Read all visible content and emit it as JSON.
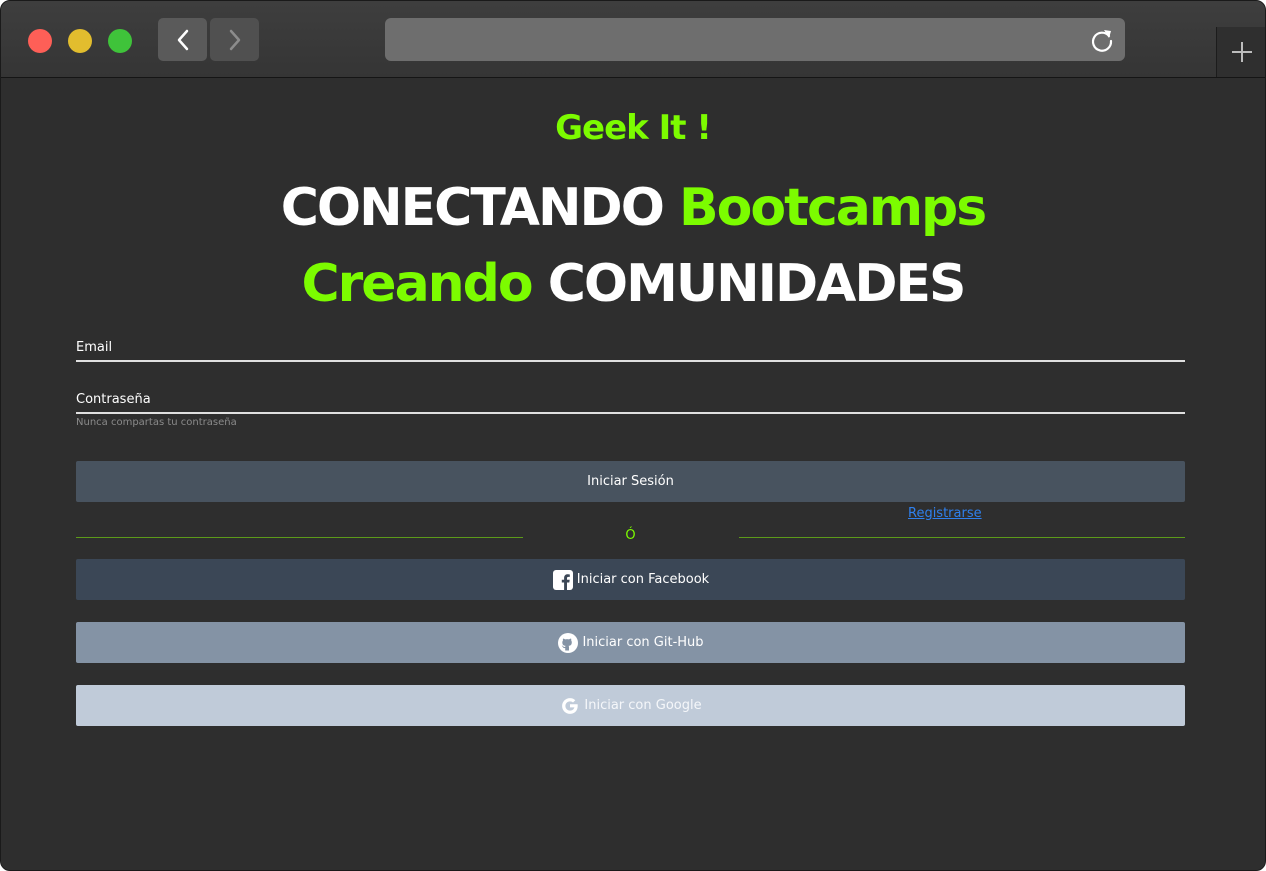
{
  "browser": {
    "back_icon": "chevron-left-icon",
    "forward_icon": "chevron-right-icon",
    "reload_icon": "reload-icon",
    "new_tab_icon": "plus-icon",
    "url": ""
  },
  "hero": {
    "brand": "Geek It !",
    "line1_a": "CONECTANDO",
    "line1_b": "Bootcamps",
    "line2_a": "Creando",
    "line2_b": "COMUNIDADES"
  },
  "form": {
    "email_label": "Email",
    "password_label": "Contraseña",
    "password_hint": "Nunca compartas tu contraseña",
    "login_button": "Iniciar Sesión",
    "register_link": "Registrarse",
    "divider": "Ó"
  },
  "social": {
    "facebook": "Iniciar con Facebook",
    "github": "Iniciar con Git-Hub",
    "google": "Iniciar con Google"
  },
  "colors": {
    "accent": "#7cfc00",
    "background": "#2e2e2e",
    "link": "#2f80ed"
  }
}
